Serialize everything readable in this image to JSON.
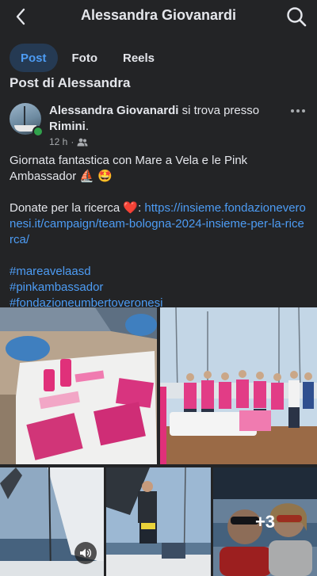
{
  "header": {
    "title": "Alessandra Giovanardi",
    "back_icon": "chevron-left-icon",
    "search_icon": "search-icon"
  },
  "tabs": [
    {
      "label": "Post",
      "active": true
    },
    {
      "label": "Foto",
      "active": false
    },
    {
      "label": "Reels",
      "active": false
    }
  ],
  "section_title": "Post di Alessandra",
  "post": {
    "author": "Alessandra Giovanardi",
    "action": " si trova presso ",
    "place": "Rimini",
    "place_suffix": ".",
    "time": "12 h",
    "time_separator": "·",
    "audience_icon": "friends-icon",
    "online": true,
    "text_line1": "Giornata fantastica con Mare a Vela e le Pink Ambassador ⛵ 🤩",
    "donate_text": "Donate per la ricerca ❤️: ",
    "link": "https://insieme.fondazioneveronesi.it/campaign/team-bologna-2024-insieme-per-la-ricerca/",
    "hashtags": [
      "#mareavelaasd",
      "#pinkambassador",
      "#fondazioneumbertoveronesi"
    ]
  },
  "photos": {
    "more_count": "+3"
  },
  "colors": {
    "background": "#232426",
    "accent": "#4d9cf4",
    "active_tab_bg": "#253a53",
    "online": "#31a24c"
  }
}
